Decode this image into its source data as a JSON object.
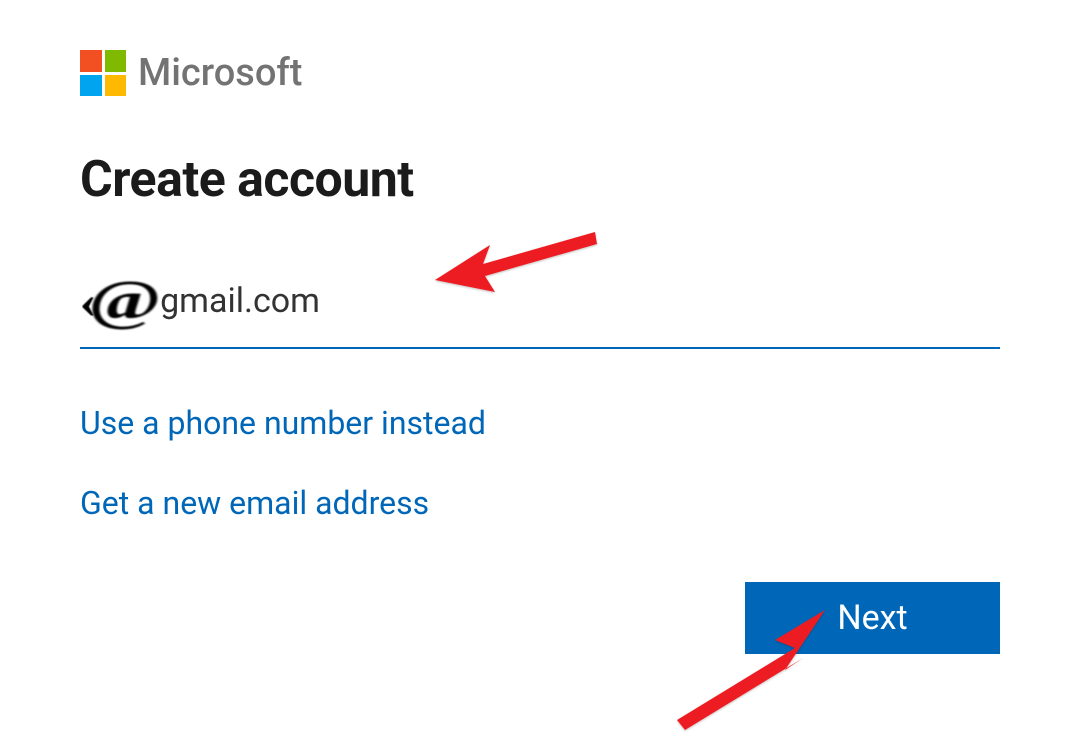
{
  "brand": {
    "name": "Microsoft",
    "logo_colors": {
      "top_left": "#F25022",
      "top_right": "#7FBA00",
      "bottom_left": "#00A4EF",
      "bottom_right": "#FFB900"
    }
  },
  "heading": "Create account",
  "email": {
    "prefix_obscured": "‹",
    "at": "@",
    "domain": "gmail.com"
  },
  "links": {
    "use_phone": "Use a phone number instead",
    "new_email": "Get a new email address"
  },
  "buttons": {
    "next": "Next"
  },
  "colors": {
    "link": "#0067b8",
    "primary_button": "#0067b8",
    "underline": "#0067b8",
    "annotation_arrow": "#ED1C24"
  }
}
